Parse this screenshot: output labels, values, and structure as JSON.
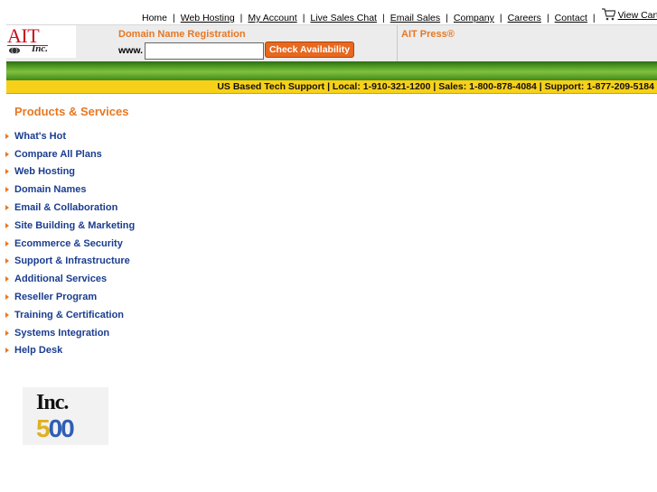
{
  "topnav": {
    "links": [
      "Home",
      "Web Hosting",
      "My Account",
      "Live Sales Chat",
      "Email Sales",
      "Company",
      "Careers",
      "Contact"
    ],
    "cart_label": "View Cart"
  },
  "logo": {
    "text": "AIT",
    "sub": "Inc."
  },
  "domain": {
    "title": "Domain Name Registration",
    "prefix": "www.",
    "input_value": "",
    "button_label": "Check Availability"
  },
  "press": {
    "title": "AIT Press®"
  },
  "support_bar": {
    "text": "US Based Tech Support | Local: 1-910-321-1200 | Sales: 1-800-878-4084 | Support: 1-877-209-5184"
  },
  "products": {
    "title": "Products & Services",
    "items": [
      "What's Hot",
      "Compare All Plans",
      "Web Hosting",
      "Domain Names",
      "Email & Collaboration",
      "Site Building & Marketing",
      "Ecommerce & Security",
      "Support & Infrastructure",
      "Additional Services",
      "Reseller Program",
      "Training & Certification",
      "Systems Integration",
      "Help Desk"
    ]
  },
  "badge": {
    "line1": "Inc.",
    "line2a": "5",
    "line2b": "00"
  },
  "colors": {
    "accent_orange": "#e87722",
    "link_blue": "#1a3d8f",
    "bar_green": "#5ea82a",
    "bar_yellow": "#f7d019",
    "logo_red": "#c8101e"
  }
}
